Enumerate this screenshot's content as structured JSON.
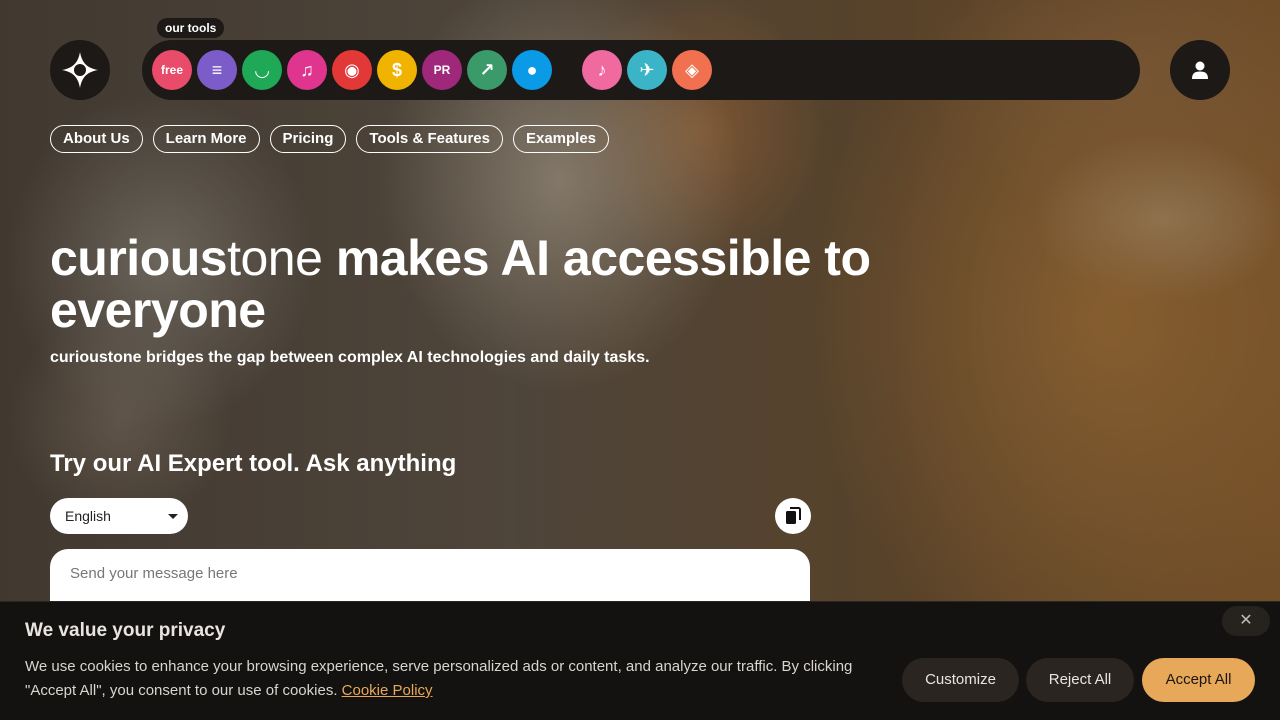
{
  "header": {
    "tools_label": "our tools",
    "tools": [
      {
        "name": "free-tool",
        "glyph": "free",
        "color": "#e94b6b"
      },
      {
        "name": "notes-tool",
        "glyph": "≡",
        "color": "#7c5cc8"
      },
      {
        "name": "bowl-tool",
        "glyph": "◡",
        "color": "#1fa855"
      },
      {
        "name": "music-swirl-tool",
        "glyph": "♫",
        "color": "#e0358e"
      },
      {
        "name": "target-tool",
        "glyph": "◉",
        "color": "#e23838"
      },
      {
        "name": "coin-tool",
        "glyph": "$",
        "color": "#f0b400"
      },
      {
        "name": "pr-tool",
        "glyph": "PR",
        "color": "#a0287a"
      },
      {
        "name": "trend-tool",
        "glyph": "↗",
        "color": "#3a9a6a"
      },
      {
        "name": "circle-tool",
        "glyph": "●",
        "color": "#0a9ae6"
      },
      {
        "name": "music-note-tool",
        "glyph": "♪",
        "color": "#f06aa0"
      },
      {
        "name": "plane-tool",
        "glyph": "✈",
        "color": "#3cb4c8"
      },
      {
        "name": "diamond-tool",
        "glyph": "◈",
        "color": "#f07050"
      }
    ]
  },
  "nav": [
    "About Us",
    "Learn More",
    "Pricing",
    "Tools & Features",
    "Examples"
  ],
  "hero": {
    "brand_bold": "curious",
    "brand_light": "tone",
    "title_rest": " makes AI accessible to everyone",
    "subtitle": "curioustone bridges the gap between complex AI technologies and daily tasks."
  },
  "tool_section": {
    "title": "Try our AI Expert tool. Ask anything",
    "language": "English",
    "message_placeholder": "Send your message here"
  },
  "cookie": {
    "title": "We value your privacy",
    "text": "We use cookies to enhance your browsing experience, serve personalized ads or content, and analyze our traffic. By clicking \"Accept All\", you consent to our use of cookies. ",
    "link": "Cookie Policy",
    "close": "✕",
    "customize": "Customize",
    "reject": "Reject All",
    "accept": "Accept All"
  }
}
